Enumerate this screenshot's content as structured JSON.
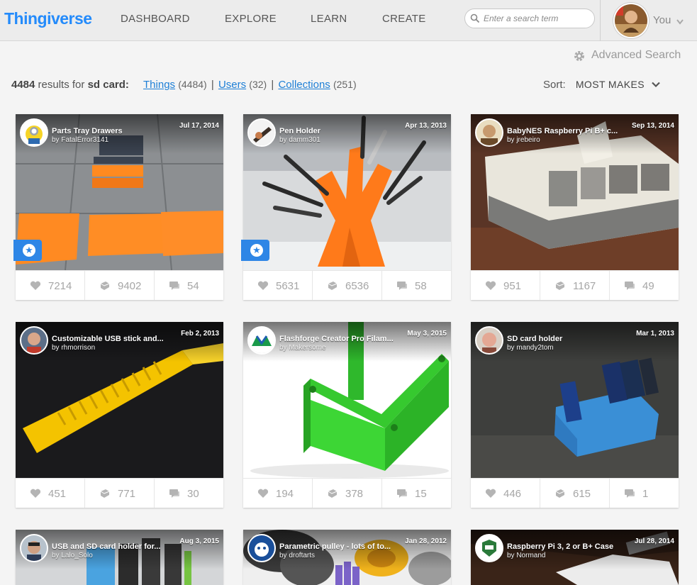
{
  "header": {
    "logo": "Thingiverse",
    "nav": [
      "DASHBOARD",
      "EXPLORE",
      "LEARN",
      "CREATE"
    ],
    "search_placeholder": "Enter a search term",
    "user_label": "You"
  },
  "advanced_search": "Advanced Search",
  "results": {
    "count": "4484",
    "text": "results for",
    "query": "sd card:",
    "tabs": [
      {
        "label": "Things",
        "count": "(4484)"
      },
      {
        "label": "Users",
        "count": "(32)"
      },
      {
        "label": "Collections",
        "count": "(251)"
      }
    ],
    "separator": "|"
  },
  "sort": {
    "label": "Sort:",
    "value": "MOST MAKES"
  },
  "cards": [
    {
      "title": "Parts Tray Drawers",
      "by": "by FatalError3141",
      "date": "Jul 17, 2014",
      "likes": "7214",
      "collects": "9402",
      "comments": "54",
      "featured": true
    },
    {
      "title": "Pen Holder",
      "by": "by damm301",
      "date": "Apr 13, 2013",
      "likes": "5631",
      "collects": "6536",
      "comments": "58",
      "featured": true
    },
    {
      "title": "BabyNES Raspberry Pi B+ c...",
      "by": "by jrebeiro",
      "date": "Sep 13, 2014",
      "likes": "951",
      "collects": "1167",
      "comments": "49",
      "featured": false
    },
    {
      "title": "Customizable USB stick and...",
      "by": "by rhmorrison",
      "date": "Feb 2, 2013",
      "likes": "451",
      "collects": "771",
      "comments": "30",
      "featured": false
    },
    {
      "title": "Flashforge Creator Pro Filam...",
      "by": "by Makersome",
      "date": "May 3, 2015",
      "likes": "194",
      "collects": "378",
      "comments": "15",
      "featured": false
    },
    {
      "title": "SD card holder",
      "by": "by mandy2tom",
      "date": "Mar 1, 2013",
      "likes": "446",
      "collects": "615",
      "comments": "1",
      "featured": false
    },
    {
      "title": "USB and SD card holder for...",
      "by": "by Lalo_Solo",
      "date": "Aug 3, 2015",
      "likes": "",
      "collects": "",
      "comments": "",
      "featured": false
    },
    {
      "title": "Parametric pulley - lots of to...",
      "by": "by droftarts",
      "date": "Jan 28, 2012",
      "likes": "",
      "collects": "",
      "comments": "",
      "featured": false
    },
    {
      "title": "Raspberry Pi 3, 2 or B+ Case",
      "by": "by Normand",
      "date": "Jul 28, 2014",
      "likes": "",
      "collects": "",
      "comments": "",
      "featured": false
    }
  ],
  "colors": {
    "brand": "#248bfb",
    "link": "#1e7fd6",
    "featured": "#2e86e6"
  },
  "icons": {
    "like": "heart-icon",
    "collect": "collect-icon",
    "comment": "comment-icon",
    "featured": "star-icon"
  }
}
